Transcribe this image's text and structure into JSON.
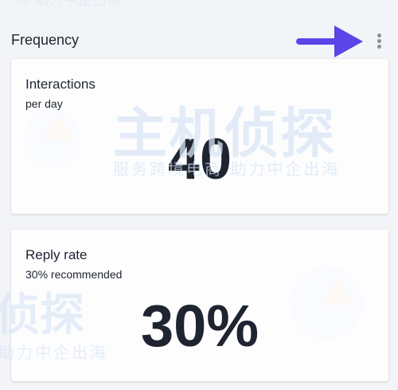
{
  "watermark": {
    "top_text": "跨   助力中企出海",
    "main_text": "主机侦探",
    "sub_text": "服务跨境电商 助力中企出海",
    "main_text_left": "侦探",
    "sub_text_left": "助力中企出海"
  },
  "section": {
    "title": "Frequency",
    "menu_icon": "kebab-vertical-icon",
    "annotation_color": "#5b45e8"
  },
  "cards": [
    {
      "title": "Interactions",
      "subtitle": "per day",
      "value": "40"
    },
    {
      "title": "Reply rate",
      "subtitle": "30% recommended",
      "value": "30%"
    }
  ]
}
